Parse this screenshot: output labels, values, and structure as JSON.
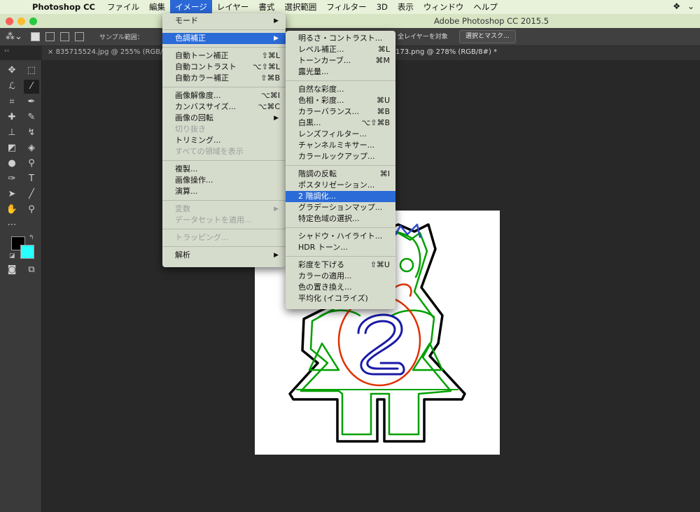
{
  "menubar": {
    "app_name": "Photoshop CC",
    "items": [
      "ファイル",
      "編集",
      "イメージ",
      "レイヤー",
      "書式",
      "選択範囲",
      "フィルター",
      "3D",
      "表示",
      "ウィンドウ",
      "ヘルプ"
    ]
  },
  "window": {
    "title": "Adobe Photoshop CC 2015.5"
  },
  "options": {
    "sample_label": "サンプル範囲：",
    "all_layers": "全レイヤーを対象",
    "select_mask": "選択とマスク..."
  },
  "tabs": {
    "tab1": "835715524.jpg @ 255% (RGB/",
    "tab2": "173.png @ 278% (RGB/8#) *"
  },
  "image_menu": {
    "mode": "モード",
    "adjustments": "色調補正",
    "auto_tone": "自動トーン補正",
    "auto_tone_sc": "⇧⌘L",
    "auto_contrast": "自動コントラスト",
    "auto_contrast_sc": "⌥⇧⌘L",
    "auto_color": "自動カラー補正",
    "auto_color_sc": "⇧⌘B",
    "image_size": "画像解像度...",
    "image_size_sc": "⌥⌘I",
    "canvas_size": "カンバスサイズ...",
    "canvas_size_sc": "⌥⌘C",
    "rotation": "画像の回転",
    "crop": "切り抜き",
    "trim": "トリミング...",
    "reveal_all": "すべての領域を表示",
    "duplicate": "複製...",
    "apply_image": "画像操作...",
    "calculations": "演算...",
    "variables": "変数",
    "apply_data_set": "データセットを適用...",
    "trap": "トラッピング...",
    "analysis": "解析"
  },
  "adjust_menu": {
    "brightness": "明るさ・コントラスト...",
    "levels": "レベル補正...",
    "levels_sc": "⌘L",
    "curves": "トーンカーブ...",
    "curves_sc": "⌘M",
    "exposure": "露光量...",
    "vibrance": "自然な彩度...",
    "hue_sat": "色相・彩度...",
    "hue_sat_sc": "⌘U",
    "color_balance": "カラーバランス...",
    "color_balance_sc": "⌘B",
    "bw": "白黒...",
    "bw_sc": "⌥⇧⌘B",
    "photo_filter": "レンズフィルター...",
    "channel_mixer": "チャンネルミキサー...",
    "color_lookup": "カラールックアップ...",
    "invert": "階調の反転",
    "invert_sc": "⌘I",
    "posterize": "ポスタリゼーション...",
    "threshold": "2 階調化...",
    "gradient_map": "グラデーションマップ...",
    "selective_color": "特定色域の選択...",
    "shadows": "シャドウ・ハイライト...",
    "hdr": "HDR トーン...",
    "desaturate": "彩度を下げる",
    "desaturate_sc": "⇧⌘U",
    "match_color": "カラーの適用...",
    "replace_color": "色の置き換え...",
    "equalize": "平均化 (イコライズ)"
  },
  "colors": {
    "foreground": "#000000",
    "background": "#29ffff",
    "menu_highlight": "#2b6bd8"
  }
}
